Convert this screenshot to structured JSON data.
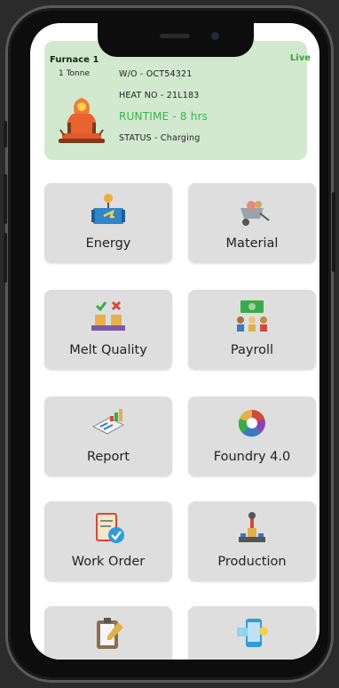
{
  "furnace": {
    "name": "Furnace 1",
    "capacity": "1 Tonne",
    "live": "Live",
    "wo": "W/O - OCT54321",
    "heat_no": "HEAT NO - 21L183",
    "runtime": "RUNTIME - 8 hrs",
    "status": "STATUS - Charging"
  },
  "tiles": [
    {
      "label": "Energy",
      "icon": "energy-icon"
    },
    {
      "label": "Material",
      "icon": "wheelbarrow-icon"
    },
    {
      "label": "Melt Quality",
      "icon": "quality-check-icon"
    },
    {
      "label": "Payroll",
      "icon": "payroll-icon"
    },
    {
      "label": "Report",
      "icon": "report-icon"
    },
    {
      "label": "Foundry 4.0",
      "icon": "color-wheel-icon"
    },
    {
      "label": "Work Order",
      "icon": "work-order-icon"
    },
    {
      "label": "Production",
      "icon": "robot-arm-icon"
    },
    {
      "label": "",
      "icon": "clipboard-icon"
    },
    {
      "label": "",
      "icon": "mobile-app-icon"
    }
  ],
  "colors": {
    "card_bg": "#d2e9cf",
    "live": "#36a52f",
    "runtime": "#39b54a",
    "tile_bg": "#dedede"
  }
}
